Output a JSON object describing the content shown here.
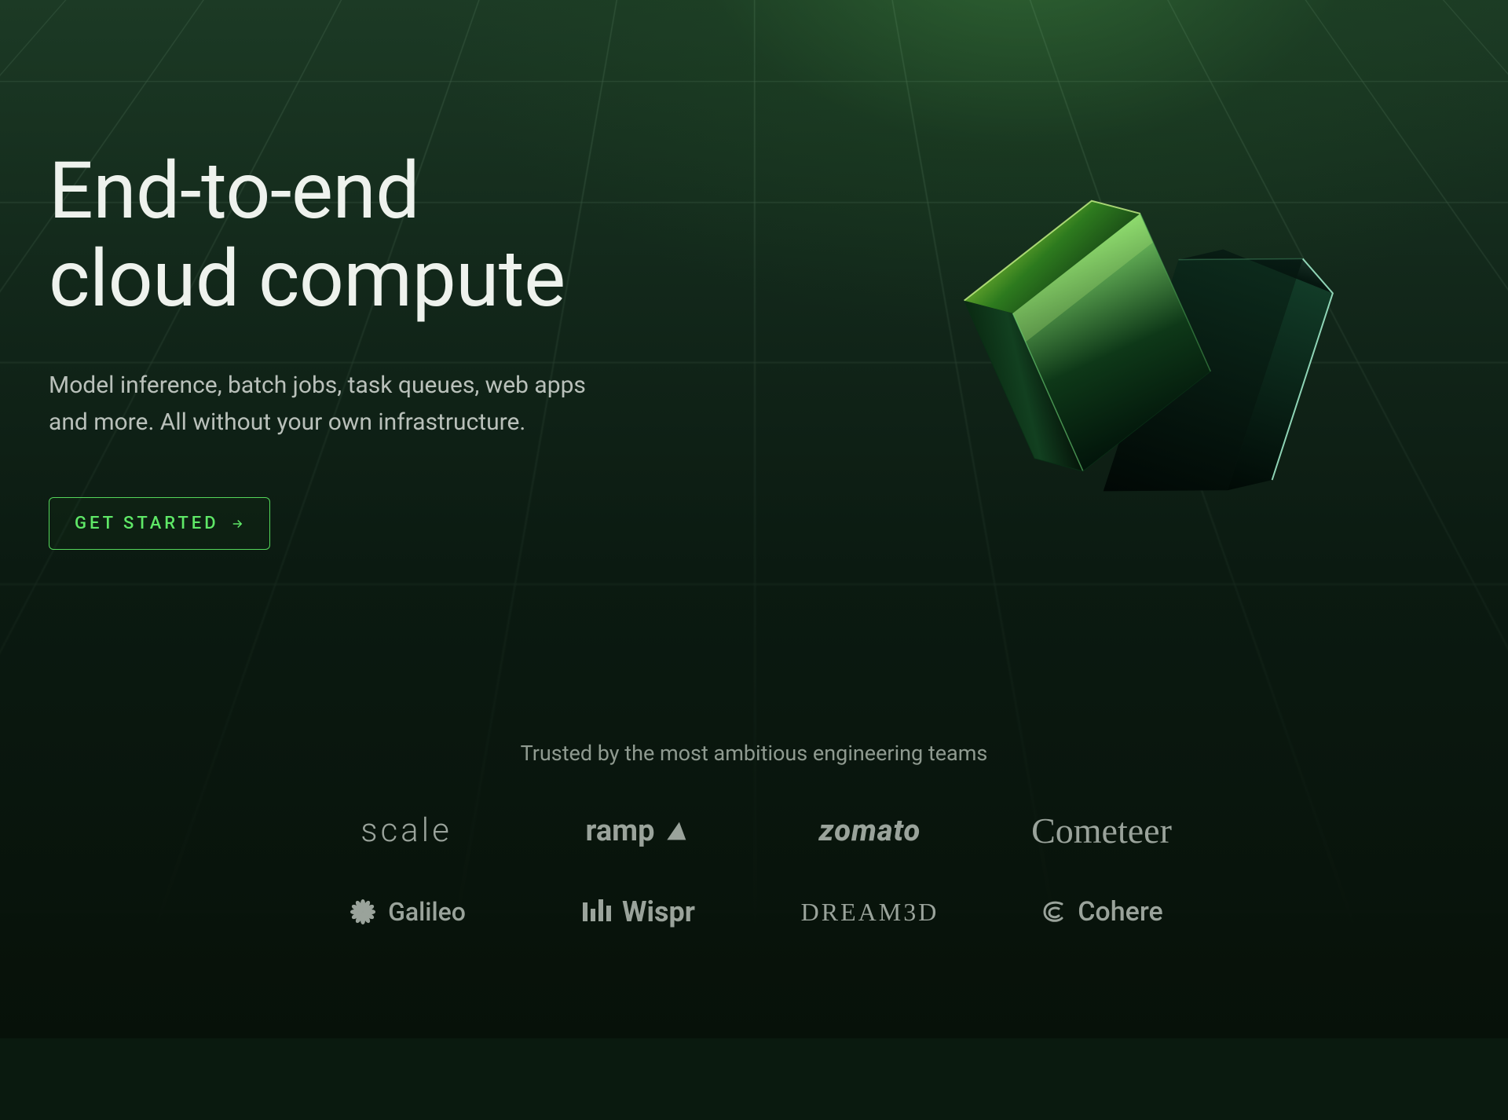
{
  "hero": {
    "headline": "End-to-end\ncloud compute",
    "subhead": "Model inference, batch jobs, task queues, web apps\nand more. All without your own infrastructure.",
    "cta_label": "GET STARTED"
  },
  "trusted": {
    "heading": "Trusted by the most ambitious engineering teams",
    "logos": [
      {
        "id": "scale",
        "label": "scale"
      },
      {
        "id": "ramp",
        "label": "ramp"
      },
      {
        "id": "zomato",
        "label": "zomato"
      },
      {
        "id": "cometeer",
        "label": "Cometeer"
      },
      {
        "id": "galileo",
        "label": "Galileo"
      },
      {
        "id": "wispr",
        "label": "Wispr"
      },
      {
        "id": "dream3d",
        "label": "DREAM3D"
      },
      {
        "id": "cohere",
        "label": "Cohere"
      }
    ]
  },
  "colors": {
    "accent_green": "#5fe867",
    "bg_dark": "#0a1a0f",
    "text_primary": "#eef2ed",
    "text_muted": "#9aa39b"
  }
}
